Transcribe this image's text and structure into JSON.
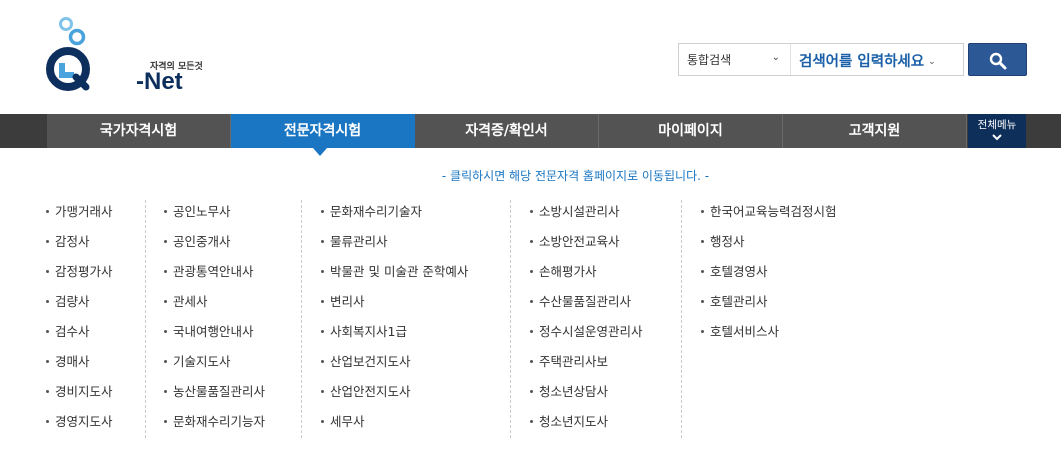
{
  "logo": {
    "tagline": "자격의 모든것",
    "name": "-Net"
  },
  "search": {
    "scope_label": "통합검색",
    "placeholder": "검색어를 입력하세요"
  },
  "colors": {
    "active": "#1a76c2",
    "nav_bg": "#535353",
    "all_menu_bg": "#0e2f5a",
    "search_btn": "#2d5896"
  },
  "nav": {
    "items": [
      {
        "label": "국가자격시험"
      },
      {
        "label": "전문자격시험"
      },
      {
        "label": "자격증/확인서"
      },
      {
        "label": "마이페이지"
      },
      {
        "label": "고객지원"
      }
    ],
    "all_menu_label": "전체메뉴"
  },
  "notice": "- 클릭하시면 해당 전문자격 홈페이지로 이동됩니다. -",
  "columns": [
    [
      "가맹거래사",
      "감정사",
      "감정평가사",
      "검량사",
      "검수사",
      "경매사",
      "경비지도사",
      "경영지도사"
    ],
    [
      "공인노무사",
      "공인중개사",
      "관광통역안내사",
      "관세사",
      "국내여행안내사",
      "기술지도사",
      "농산물품질관리사",
      "문화재수리기능자"
    ],
    [
      "문화재수리기술자",
      "물류관리사",
      "박물관 및 미술관 준학예사",
      "변리사",
      "사회복지사1급",
      "산업보건지도사",
      "산업안전지도사",
      "세무사"
    ],
    [
      "소방시설관리사",
      "소방안전교육사",
      "손해평가사",
      "수산물품질관리사",
      "정수시설운영관리사",
      "주택관리사보",
      "청소년상담사",
      "청소년지도사"
    ],
    [
      "한국어교육능력검정시험",
      "행정사",
      "호텔경영사",
      "호텔관리사",
      "호텔서비스사"
    ]
  ]
}
